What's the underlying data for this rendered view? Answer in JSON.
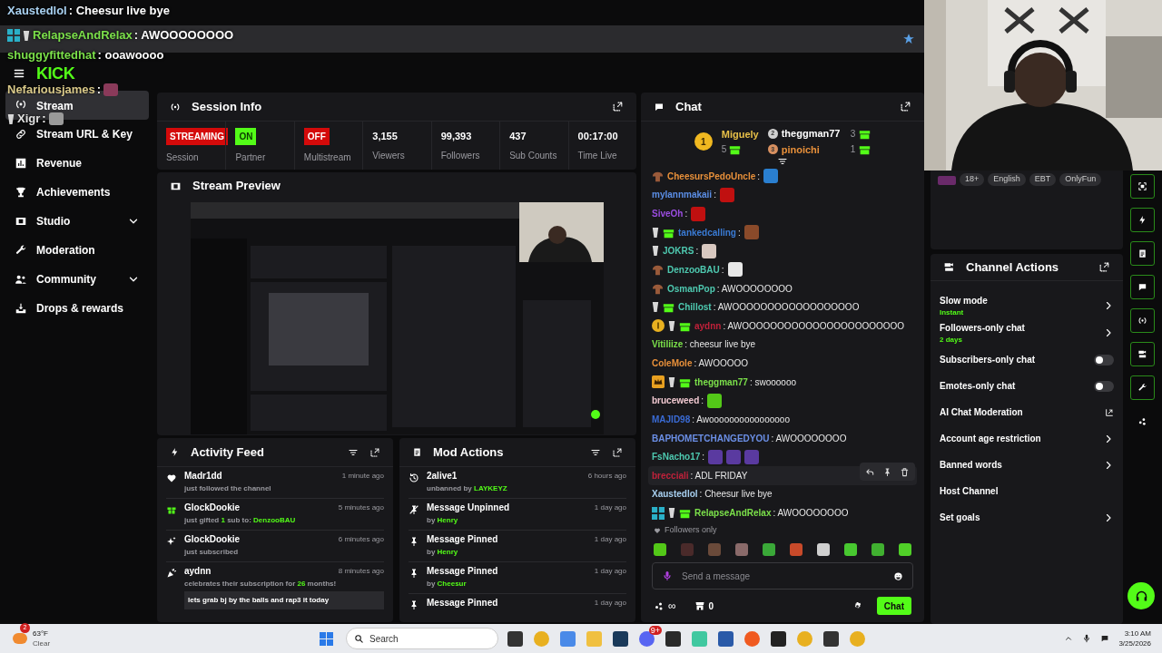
{
  "stream_overlay": {
    "logo": "KICK",
    "lines": [
      {
        "user": "Xaustedlol",
        "color": "#a8d0f0",
        "text": ": Cheesur live bye"
      },
      {
        "user": "RelapseAndRelax",
        "color": "#7be04a",
        "text": ": AWOOOOOOOO",
        "badges": [
          {
            "kind": "og"
          },
          {
            "kind": "cup"
          }
        ]
      },
      {
        "user": "shuggyfittedhat",
        "color": "#7be04a",
        "text": ": ooawoooo"
      },
      {
        "user": "Nefariousjames",
        "color": "#d8c888",
        "text": ":",
        "emotes": [
          {
            "color": "#8a3a5a"
          }
        ]
      },
      {
        "user": "Xigr",
        "color": "#e0e0e0",
        "text": ":",
        "badges": [
          {
            "kind": "cup"
          }
        ],
        "emotes": [
          {
            "color": "#9a9a9a"
          }
        ]
      }
    ]
  },
  "sidebar": {
    "items": [
      {
        "kind": "broadcast",
        "label": "Stream",
        "selected": true,
        "expandable": false
      },
      {
        "kind": "link",
        "label": "Stream URL & Key",
        "selected": false,
        "expandable": false
      },
      {
        "kind": "chart",
        "label": "Revenue",
        "selected": false,
        "expandable": false
      },
      {
        "kind": "trophy",
        "label": "Achievements",
        "selected": false,
        "expandable": false
      },
      {
        "kind": "film",
        "label": "Studio",
        "selected": false,
        "expandable": true
      },
      {
        "kind": "wrench",
        "label": "Moderation",
        "selected": false,
        "expandable": false
      },
      {
        "kind": "people",
        "label": "Community",
        "selected": false,
        "expandable": true
      },
      {
        "kind": "drops",
        "label": "Drops & rewards",
        "selected": false,
        "expandable": false
      }
    ]
  },
  "session_info": {
    "title": "Session Info",
    "stats": [
      {
        "kind": "status",
        "value": "STREAMING",
        "color": "#d40a0a",
        "label": "Session"
      },
      {
        "kind": "status",
        "value": "ON",
        "color": "#53fc18",
        "label": "Partner"
      },
      {
        "kind": "status",
        "value": "OFF",
        "color": "#d40a0a",
        "label": "Multistream"
      },
      {
        "kind": "number",
        "value": "3,155",
        "label": "Viewers"
      },
      {
        "kind": "number",
        "value": "99,393",
        "label": "Followers"
      },
      {
        "kind": "number",
        "value": "437",
        "label": "Sub Counts"
      },
      {
        "kind": "number",
        "value": "00:17:00",
        "label": "Time Live"
      }
    ]
  },
  "stream_preview": {
    "title": "Stream Preview"
  },
  "activity_feed": {
    "title": "Activity Feed",
    "items": [
      {
        "kind": "follow",
        "user": "Madr1dd",
        "time": "1 minute ago",
        "detail": "just followed the channel"
      },
      {
        "kind": "gift",
        "user": "GlockDookie",
        "time": "5 minutes ago",
        "detail": "just gifted **1** sub to: **DenzooBAU**"
      },
      {
        "kind": "subscribe",
        "user": "GlockDookie",
        "time": "6 minutes ago",
        "detail": "just subscribed"
      },
      {
        "kind": "resub",
        "user": "aydnn",
        "time": "8 minutes ago",
        "detail": "celebrates their subscription for **26** months!",
        "message": "lets grab bj by the balls and rap3 it today"
      }
    ]
  },
  "mod_actions": {
    "title": "Mod Actions",
    "items": [
      {
        "kind": "unban",
        "title": "2alive1",
        "time": "6 hours ago",
        "detail": "unbanned by **LAYKEYZ**"
      },
      {
        "kind": "unpin",
        "title": "Message Unpinned",
        "time": "1 day ago",
        "detail": "by **Henry**"
      },
      {
        "kind": "pin",
        "title": "Message Pinned",
        "time": "1 day ago",
        "detail": "by **Henry**"
      },
      {
        "kind": "pin",
        "title": "Message Pinned",
        "time": "1 day ago",
        "detail": "by **Cheesur**"
      },
      {
        "kind": "pin",
        "title": "Message Pinned",
        "time": "1 day ago"
      }
    ]
  },
  "chat": {
    "title": "Chat",
    "leaders": [
      {
        "rank": "1",
        "user": "Miguely",
        "color": "#e8c048",
        "count": "5"
      },
      {
        "rank": "2",
        "user": "theggman77",
        "color": "#ffffff",
        "count": "3"
      },
      {
        "rank": "3",
        "user": "pinoichi",
        "color": "#e8903a",
        "count": "1"
      }
    ],
    "messages": [
      {
        "user": "CheesursPedoUncle",
        "color": "#e8903a",
        "text": ":",
        "badges": [
          {
            "kind": "mushroom"
          }
        ],
        "emotes": [
          {
            "color": "#2a7fd0"
          }
        ],
        "hovered": false
      },
      {
        "user": "mylannmakaii",
        "color": "#5b8ee6",
        "text": ":",
        "emotes": [
          {
            "color": "#c01010"
          }
        ],
        "hovered": false
      },
      {
        "user": "SiveOh",
        "color": "#9b4de0",
        "text": ":",
        "emotes": [
          {
            "color": "#c01010"
          }
        ],
        "hovered": false
      },
      {
        "user": "tankedcalling",
        "color": "#3a7bd5",
        "text": ":",
        "badges": [
          {
            "kind": "cup"
          },
          {
            "kind": "gift"
          }
        ],
        "emotes": [
          {
            "color": "#8a4a2a"
          }
        ],
        "hovered": false
      },
      {
        "user": "JOKRS",
        "color": "#4ec9b0",
        "text": ":",
        "badges": [
          {
            "kind": "cup"
          }
        ],
        "emotes": [
          {
            "color": "#d8c8c0"
          }
        ],
        "hovered": false
      },
      {
        "user": "DenzooBAU",
        "color": "#4ec9b0",
        "text": ":",
        "badges": [
          {
            "kind": "mushroom"
          }
        ],
        "emotes": [
          {
            "color": "#e8e8e8"
          }
        ],
        "hovered": false
      },
      {
        "user": "OsmanPop",
        "color": "#4ec9b0",
        "text": ": AWOOOOOOOO",
        "badges": [
          {
            "kind": "mushroom"
          }
        ],
        "hovered": false
      },
      {
        "user": "Chillost",
        "color": "#4ec9b0",
        "text": ": AWOOOOOOOOOOOOOOOOOO",
        "badges": [
          {
            "kind": "cup"
          },
          {
            "kind": "gift"
          }
        ],
        "hovered": false
      },
      {
        "user": "aydnn",
        "color": "#c0213a",
        "text": ": AWOOOOOOOOOOOOOOOOOOOOOOO",
        "badges": [
          {
            "kind": "coin"
          },
          {
            "kind": "cup"
          },
          {
            "kind": "gift"
          }
        ],
        "hovered": false
      },
      {
        "user": "Vitiliize",
        "color": "#7be04a",
        "text": ": cheesur live bye",
        "hovered": false
      },
      {
        "user": "ColeMole",
        "color": "#e8903a",
        "text": ": AWOOOOO",
        "hovered": false
      },
      {
        "user": "theggman77",
        "color": "#7be04a",
        "text": ": swoooooo",
        "badges": [
          {
            "kind": "crown"
          },
          {
            "kind": "cup"
          },
          {
            "kind": "gift"
          }
        ],
        "hovered": false
      },
      {
        "user": "bruceweed",
        "color": "#f0c8d0",
        "text": ":",
        "emotes": [
          {
            "color": "#53c818"
          }
        ],
        "hovered": false
      },
      {
        "user": "MAJID98",
        "color": "#3a6bd5",
        "text": ": Awoooooooooooooooo",
        "hovered": false
      },
      {
        "user": "BAPHOMETCHANGEDYOU",
        "color": "#6b8fe6",
        "text": ": AWOOOOOOOO",
        "hovered": false
      },
      {
        "user": "FsNacho17",
        "color": "#4ec9b0",
        "text": ":",
        "emotes": [
          {
            "color": "#5a3aa0"
          },
          {
            "color": "#5a3aa0"
          },
          {
            "color": "#5a3aa0"
          }
        ],
        "hovered": false
      },
      {
        "user": "brecciali",
        "color": "#c0213a",
        "text": ": ADL FRIDAY",
        "hovered": true
      },
      {
        "user": "Xaustedlol",
        "color": "#a8d0f0",
        "text": ": Cheesur live bye",
        "hovered": false
      },
      {
        "user": "RelapseAndRelax",
        "color": "#7be04a",
        "text": ": AWOOOOOOOO",
        "badges": [
          {
            "kind": "og"
          },
          {
            "kind": "cup"
          },
          {
            "kind": "gift"
          }
        ],
        "hovered": false
      }
    ],
    "mode": "Followers only",
    "quick_emotes": [
      {
        "color": "#53c818"
      },
      {
        "color": "#4a2a2a"
      },
      {
        "color": "#6a4a3a"
      },
      {
        "color": "#8a6a6a"
      },
      {
        "color": "#3aa838"
      },
      {
        "color": "#c84a2a"
      },
      {
        "color": "#d0d0d0"
      },
      {
        "color": "#48c830"
      },
      {
        "color": "#40b030"
      },
      {
        "color": "#50d028"
      }
    ],
    "input": {
      "placeholder": "Send a message"
    },
    "points": "∞",
    "store_count": "0",
    "send": "Chat"
  },
  "channel_info": {
    "tags": [
      "18+",
      "English",
      "EBT",
      "OnlyFun"
    ]
  },
  "channel_actions": {
    "title": "Channel Actions",
    "items": [
      {
        "kind": "nav",
        "label": "Slow mode",
        "value": "Instant"
      },
      {
        "kind": "nav",
        "label": "Followers-only chat",
        "value": "2 days"
      },
      {
        "kind": "toggle",
        "label": "Subscribers-only chat",
        "on": false
      },
      {
        "kind": "toggle",
        "label": "Emotes-only chat",
        "on": false
      },
      {
        "kind": "external",
        "label": "AI Chat Moderation"
      },
      {
        "kind": "nav",
        "label": "Account age restriction"
      },
      {
        "kind": "nav",
        "label": "Banned words"
      },
      {
        "kind": "plain",
        "label": "Host Channel"
      },
      {
        "kind": "nav",
        "label": "Set goals"
      }
    ]
  },
  "rail": [
    {
      "kind": "scan",
      "pinned": true
    },
    {
      "kind": "bolt",
      "pinned": true
    },
    {
      "kind": "doc",
      "pinned": true
    },
    {
      "kind": "chat",
      "pinned": true
    },
    {
      "kind": "broadcast",
      "pinned": true
    },
    {
      "kind": "channel",
      "pinned": true
    },
    {
      "kind": "wrench",
      "pinned": true
    },
    {
      "kind": "dots",
      "pinned": false
    }
  ],
  "taskbar": {
    "weather": {
      "badge": "2",
      "temp": "63°F",
      "condition": "Clear"
    },
    "search": {
      "placeholder": "Search"
    },
    "apps": [
      {
        "kind": "taskview"
      },
      {
        "kind": "chrome"
      },
      {
        "kind": "copilot"
      },
      {
        "kind": "folder"
      },
      {
        "kind": "steam"
      },
      {
        "kind": "discord",
        "badge": "9+"
      },
      {
        "kind": "obs"
      },
      {
        "kind": "robot"
      },
      {
        "kind": "terminal"
      },
      {
        "kind": "brave"
      },
      {
        "kind": "chess"
      },
      {
        "kind": "chrome"
      },
      {
        "kind": "capture"
      },
      {
        "kind": "chrome"
      }
    ],
    "time": "3:10 AM",
    "date": "3/25/2026"
  }
}
